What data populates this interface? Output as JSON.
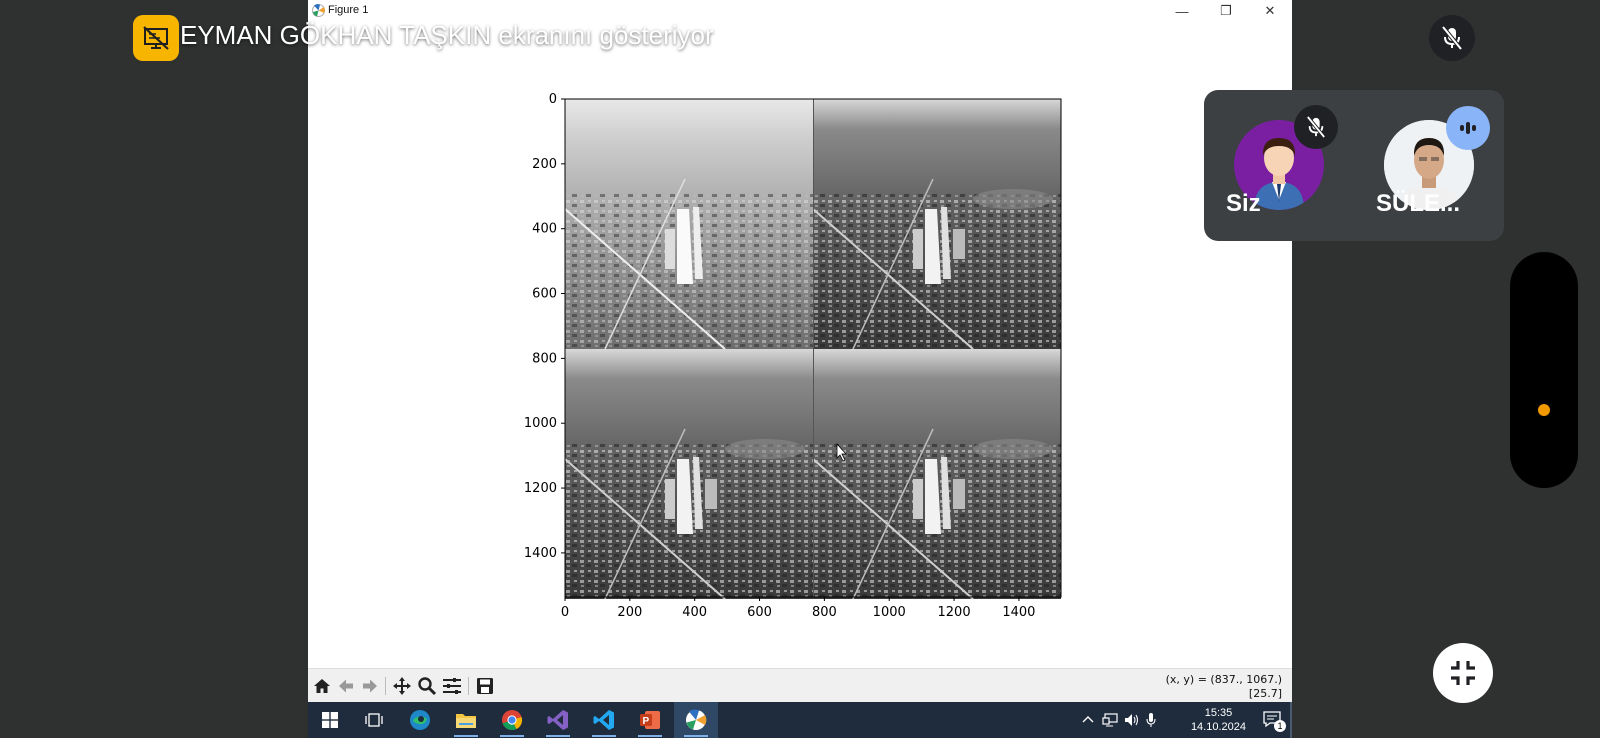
{
  "window": {
    "title": "Figure 1",
    "minimize_glyph": "—",
    "restore_glyph": "❐",
    "close_glyph": "✕"
  },
  "plot": {
    "y_ticks": [
      "0",
      "200",
      "400",
      "600",
      "800",
      "1000",
      "1200",
      "1400"
    ],
    "x_ticks": [
      "0",
      "200",
      "400",
      "600",
      "800",
      "1000",
      "1200",
      "1400"
    ],
    "image_description_icon": "grayscale-airport-aerial-image-2x2-mosaic"
  },
  "toolbar": {
    "icons": [
      "home-icon",
      "back-icon",
      "forward-icon",
      "pan-icon",
      "zoom-icon",
      "configure-icon",
      "save-icon"
    ],
    "coords_line1": "(x, y) = (837., 1067.)",
    "coords_line2": "[25.7]"
  },
  "taskbar": {
    "apps": [
      "windows-start-icon",
      "task-view-icon",
      "edge-icon",
      "file-explorer-icon",
      "chrome-icon",
      "visual-studio-icon",
      "vscode-icon",
      "powerpoint-icon",
      "matplotlib-icon"
    ],
    "time": "15:35",
    "date": "14.10.2024",
    "notification_count": "1"
  },
  "meet": {
    "presenter_text": "EYMAN GÖKHAN TAŞKIN ekranını gösteriyor",
    "tiles": [
      {
        "name": "Siz",
        "muted": true
      },
      {
        "name": "SÜLE...",
        "speaking": true
      }
    ],
    "accent": "#f7b500",
    "indicator_color": "#f29900"
  }
}
